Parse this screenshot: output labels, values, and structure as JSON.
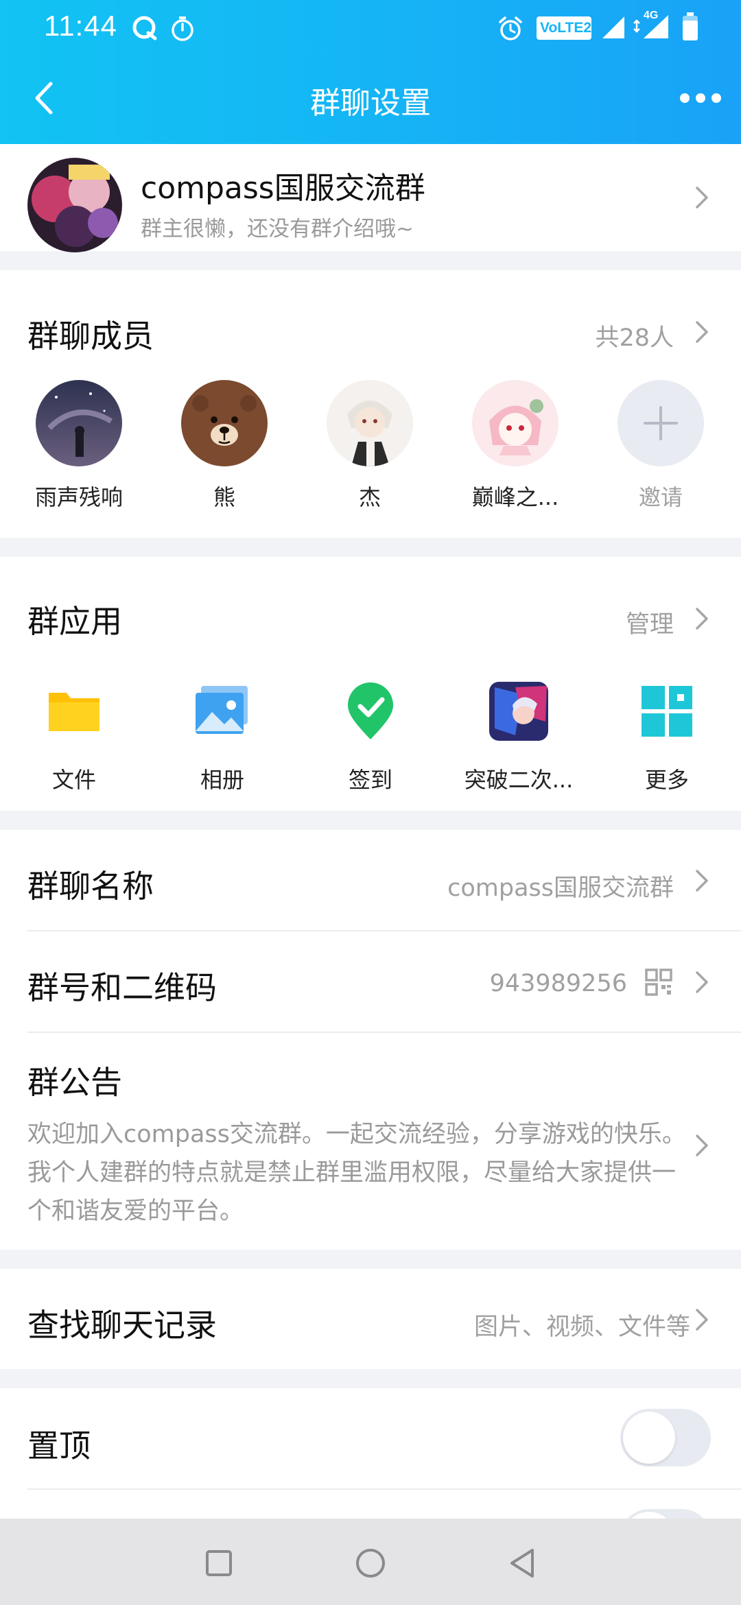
{
  "status": {
    "time": "11:44",
    "volte_label": "VoLTE2",
    "network_label": "4G"
  },
  "nav": {
    "title": "群聊设置"
  },
  "group": {
    "name": "compass国服交流群",
    "intro": "群主很懒，还没有群介绍哦~"
  },
  "members": {
    "title": "群聊成员",
    "count_label": "共28人",
    "list": [
      {
        "name": "雨声残响"
      },
      {
        "name": "熊"
      },
      {
        "name": "杰"
      },
      {
        "name": "巅峰之..."
      }
    ],
    "invite_label": "邀请"
  },
  "apps": {
    "title": "群应用",
    "manage_label": "管理",
    "list": [
      {
        "name": "文件",
        "icon": "folder-icon"
      },
      {
        "name": "相册",
        "icon": "album-icon"
      },
      {
        "name": "签到",
        "icon": "checkin-icon"
      },
      {
        "name": "突破二次...",
        "icon": "game-app-icon"
      },
      {
        "name": "更多",
        "icon": "grid-icon"
      }
    ]
  },
  "info": {
    "group_name_label": "群聊名称",
    "group_name_value": "compass国服交流群",
    "group_id_label": "群号和二维码",
    "group_id_value": "943989256",
    "notice_label": "群公告",
    "notice_text": "欢迎加入compass交流群。一起交流经验，分享游戏的快乐。我个人建群的特点就是禁止群里滥用权限，尽量给大家提供一个和谐友爱的平台。"
  },
  "search": {
    "label": "查找聊天记录",
    "hint": "图片、视频、文件等"
  },
  "pin": {
    "label": "置顶",
    "enabled": false
  },
  "colors": {
    "header_start": "#12c3f3",
    "header_end": "#19a2f7",
    "gray_text": "#a0a0a0"
  }
}
